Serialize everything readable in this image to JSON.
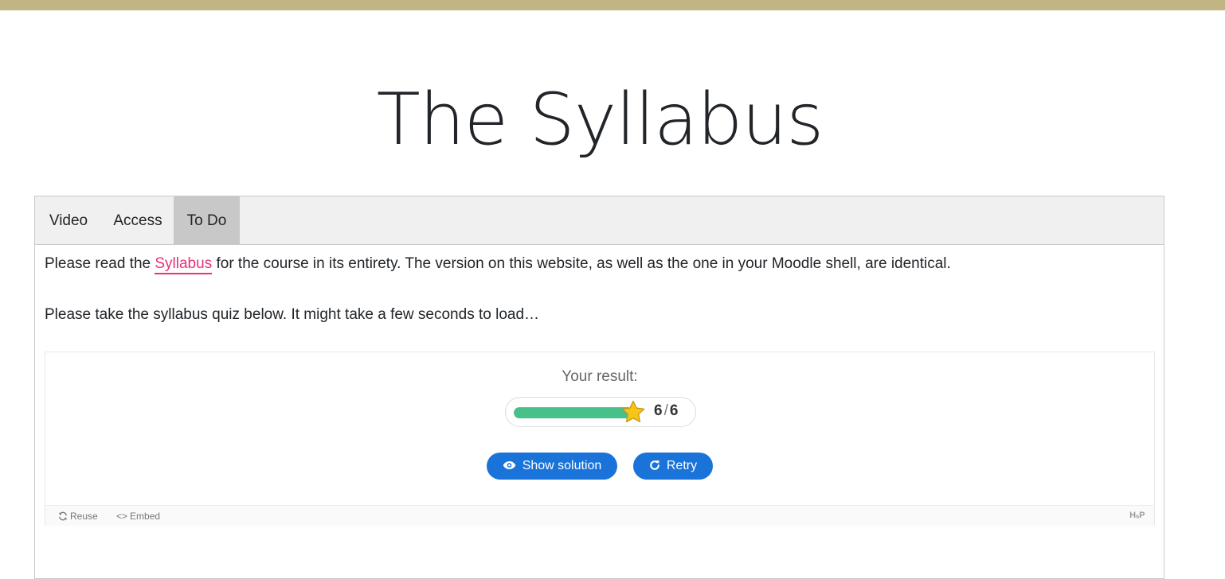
{
  "page": {
    "title": "The Syllabus"
  },
  "tabs": [
    {
      "label": "Video",
      "active": false
    },
    {
      "label": "Access",
      "active": false
    },
    {
      "label": "To Do",
      "active": true
    }
  ],
  "content": {
    "para1_before": "Please read the ",
    "para1_link": "Syllabus",
    "para1_after": " for the course in its entirety. The version on this website, as well as the one in your Moodle shell, are identical.",
    "para2": "Please take the syllabus quiz below. It might take a few seconds to load…"
  },
  "quiz": {
    "result_label": "Your result:",
    "score": 6,
    "max_score": 6,
    "score_separator": "/",
    "progress_fraction": 1.0,
    "show_solution_label": "Show solution",
    "retry_label": "Retry",
    "footer": {
      "reuse_label": "Reuse",
      "embed_label": "Embed",
      "logo_text": "H₅P"
    }
  },
  "colors": {
    "top_bar": "#c2b483",
    "link": "#e8317a",
    "button": "#1a73d9",
    "progress": "#47c08a",
    "star": "#f5c518"
  },
  "icons": [
    "star-icon",
    "eye-icon",
    "retry-icon",
    "reuse-icon",
    "embed-icon"
  ]
}
